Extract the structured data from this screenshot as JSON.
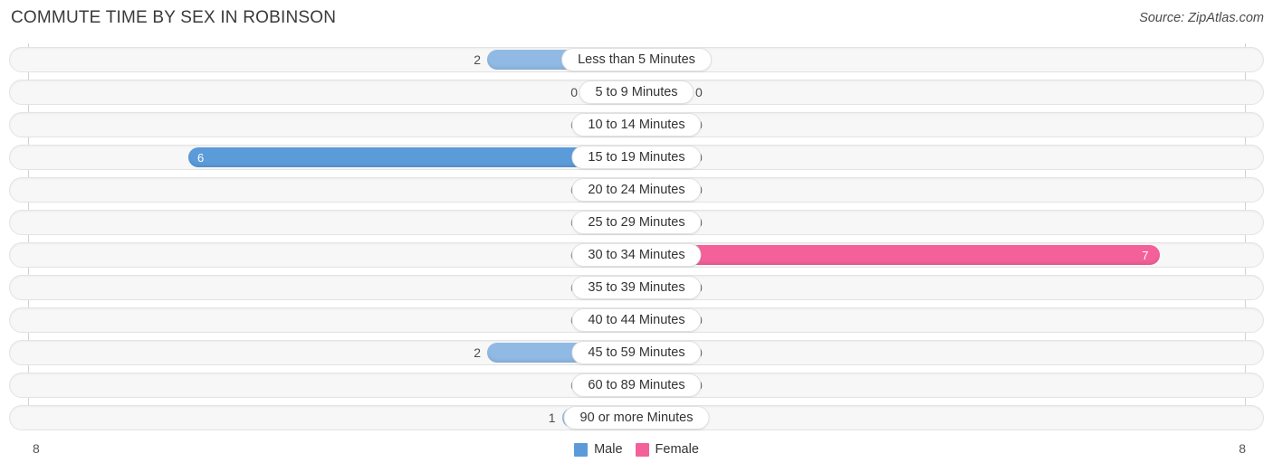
{
  "header": {
    "title": "COMMUTE TIME BY SEX IN ROBINSON",
    "source": "Source: ZipAtlas.com"
  },
  "legend": {
    "items": [
      {
        "label": "Male",
        "color": "#5b9bd9"
      },
      {
        "label": "Female",
        "color": "#f4609a"
      }
    ]
  },
  "axis": {
    "left_tick": "8",
    "right_tick": "8",
    "max": 8
  },
  "colors": {
    "male_light": "#90bae4",
    "male_strong": "#5b9bd9",
    "female_light": "#f9a8c4",
    "female_strong": "#f4609a",
    "track": "#f7f7f7",
    "track_border": "#e3e3e3"
  },
  "chart_data": {
    "type": "bar",
    "title": "COMMUTE TIME BY SEX IN ROBINSON",
    "orientation": "horizontal-diverging",
    "xlabel": "",
    "ylabel": "",
    "xlim": [
      8,
      8
    ],
    "grid": false,
    "legend_position": "bottom-center",
    "categories": [
      "Less than 5 Minutes",
      "5 to 9 Minutes",
      "10 to 14 Minutes",
      "15 to 19 Minutes",
      "20 to 24 Minutes",
      "25 to 29 Minutes",
      "30 to 34 Minutes",
      "35 to 39 Minutes",
      "40 to 44 Minutes",
      "45 to 59 Minutes",
      "60 to 89 Minutes",
      "90 or more Minutes"
    ],
    "series": [
      {
        "name": "Male",
        "values": [
          2,
          0,
          0,
          6,
          0,
          0,
          0,
          0,
          0,
          2,
          0,
          1
        ]
      },
      {
        "name": "Female",
        "values": [
          0,
          0,
          0,
          0,
          0,
          0,
          7,
          0,
          0,
          0,
          0,
          0
        ]
      }
    ]
  },
  "rows": [
    {
      "label": "Less than 5 Minutes",
      "male": "2",
      "female": "0",
      "male_pct": 25,
      "female_pct": 0,
      "male_hi": false,
      "female_hi": false
    },
    {
      "label": "5 to 9 Minutes",
      "male": "0",
      "female": "0",
      "male_pct": 0,
      "female_pct": 0,
      "male_hi": false,
      "female_hi": false
    },
    {
      "label": "10 to 14 Minutes",
      "male": "0",
      "female": "0",
      "male_pct": 0,
      "female_pct": 0,
      "male_hi": false,
      "female_hi": false
    },
    {
      "label": "15 to 19 Minutes",
      "male": "6",
      "female": "0",
      "male_pct": 75,
      "female_pct": 0,
      "male_hi": true,
      "female_hi": false
    },
    {
      "label": "20 to 24 Minutes",
      "male": "0",
      "female": "0",
      "male_pct": 0,
      "female_pct": 0,
      "male_hi": false,
      "female_hi": false
    },
    {
      "label": "25 to 29 Minutes",
      "male": "0",
      "female": "0",
      "male_pct": 0,
      "female_pct": 0,
      "male_hi": false,
      "female_hi": false
    },
    {
      "label": "30 to 34 Minutes",
      "male": "0",
      "female": "7",
      "male_pct": 0,
      "female_pct": 87.5,
      "male_hi": false,
      "female_hi": true
    },
    {
      "label": "35 to 39 Minutes",
      "male": "0",
      "female": "0",
      "male_pct": 0,
      "female_pct": 0,
      "male_hi": false,
      "female_hi": false
    },
    {
      "label": "40 to 44 Minutes",
      "male": "0",
      "female": "0",
      "male_pct": 0,
      "female_pct": 0,
      "male_hi": false,
      "female_hi": false
    },
    {
      "label": "45 to 59 Minutes",
      "male": "2",
      "female": "0",
      "male_pct": 25,
      "female_pct": 0,
      "male_hi": false,
      "female_hi": false
    },
    {
      "label": "60 to 89 Minutes",
      "male": "0",
      "female": "0",
      "male_pct": 0,
      "female_pct": 0,
      "male_hi": false,
      "female_hi": false
    },
    {
      "label": "90 or more Minutes",
      "male": "1",
      "female": "0",
      "male_pct": 12.5,
      "female_pct": 0,
      "male_hi": false,
      "female_hi": false
    }
  ]
}
